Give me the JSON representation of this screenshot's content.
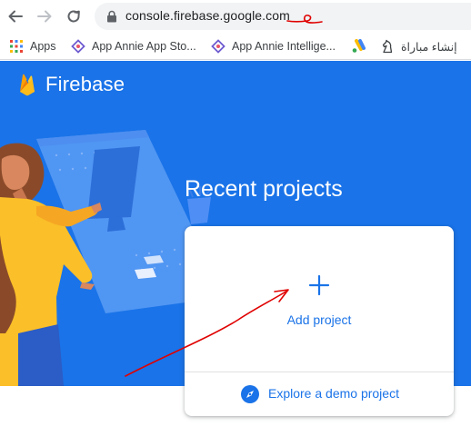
{
  "browser": {
    "url": "console.firebase.google.com"
  },
  "bookmarks": [
    {
      "label": "Apps",
      "icon": "apps-grid-icon"
    },
    {
      "label": "App Annie App Sto...",
      "icon": "app-annie-icon"
    },
    {
      "label": "App Annie Intellige...",
      "icon": "app-annie-icon"
    },
    {
      "label": "",
      "icon": "google-ads-icon"
    },
    {
      "label": "إنشاء مباراة",
      "icon": "chess-knight-icon"
    }
  ],
  "firebase": {
    "brand": "Firebase",
    "heading": "Recent projects",
    "add_project_label": "Add project",
    "explore_demo_label": "Explore a demo project"
  },
  "colors": {
    "hero_blue": "#1a73e8",
    "link_blue": "#1a73e8",
    "annotation_red": "#e00000"
  }
}
